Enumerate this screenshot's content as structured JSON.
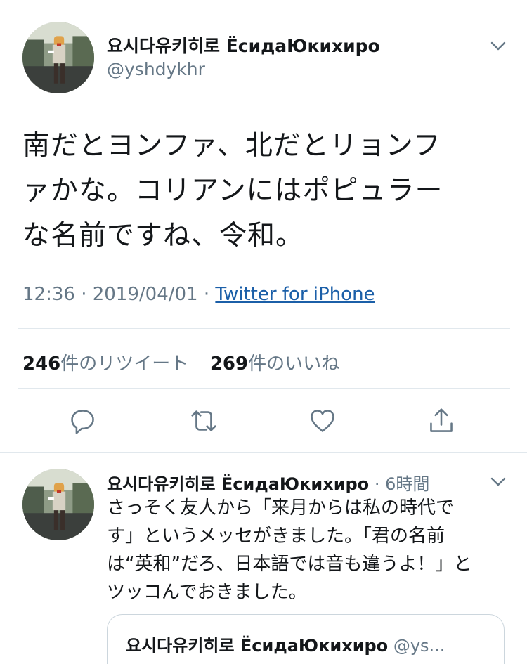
{
  "tweet": {
    "author_name": "요시다유키히로 ЁсидаЮкихиро",
    "author_handle": "@yshdykhr",
    "text_lines": [
      "南だとヨンファ、北だとリョンフ",
      "ァかな。コリアンにはポピュラー",
      "な名前ですね、令和。"
    ],
    "timestamp": "12:36 · 2019/04/01 · ",
    "source": "Twitter for iPhone",
    "retweet_count": "246",
    "retweet_label": "件のリツイート",
    "like_count": "269",
    "like_label": "件のいいね",
    "actions": [
      "reply-icon",
      "retweet-icon",
      "like-icon",
      "share-icon"
    ]
  },
  "reply": {
    "author_name": "요시다유키히로 ЁсидаЮкихиро",
    "time": "· 6時間",
    "text_lines": [
      "さっそく友人から「来月からは私の時代で",
      "す」というメッセがきました。「君の名前",
      "は“英和”だろ、日本語では音も違うよ！」と",
      "ツッコんでおきました。"
    ]
  },
  "quote": {
    "author_name": "요시다유키히로 ЁсидаЮкихиро",
    "author_handle": "@ys..."
  },
  "colors": {
    "text": "#14171a",
    "secondary": "#657786",
    "link": "#1b5fa8",
    "divider": "#e1e8ed"
  }
}
